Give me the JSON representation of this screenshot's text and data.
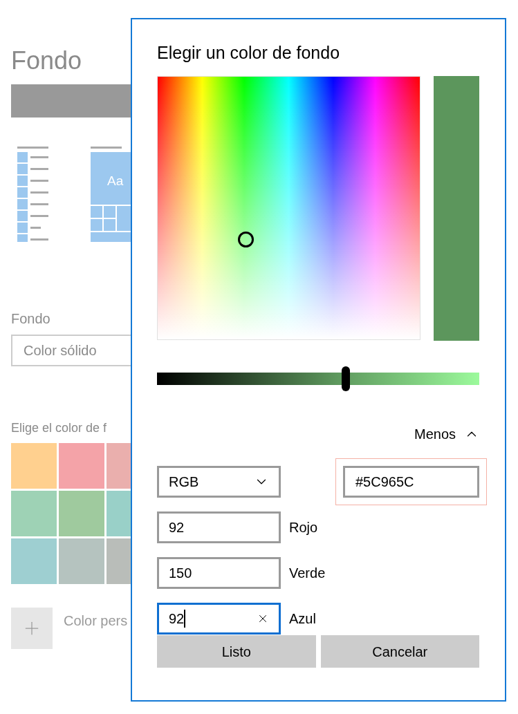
{
  "page": {
    "title": "Fondo",
    "tile_label": "Aa",
    "background_label": "Fondo",
    "background_select": "Color sólido",
    "swatches_label": "Elige el color de f",
    "swatches": [
      {
        "color": "#ffd08f"
      },
      {
        "color": "#f4a3a8"
      },
      {
        "color": "#eaafad"
      },
      {
        "color": "#9ed2b5"
      },
      {
        "color": "#9fca9e"
      },
      {
        "color": "#99d0c8"
      },
      {
        "color": "#9ecfd1"
      },
      {
        "color": "#b5c3bf"
      },
      {
        "color": "#b9bdb9"
      }
    ],
    "custom_color_label": "Color pers"
  },
  "dialog": {
    "title": "Elegir un color de fondo",
    "brightness": {
      "level": 0.586
    },
    "toggle": "Menos",
    "mode": "RGB",
    "hex": {
      "value": "#5C965C",
      "highlighted": true
    },
    "channels": [
      {
        "value": "92",
        "label": "Rojo",
        "focused": false
      },
      {
        "value": "150",
        "label": "Verde",
        "focused": false
      },
      {
        "value": "92",
        "label": "Azul",
        "focused": true
      }
    ],
    "buttons": [
      "Listo",
      "Cancelar"
    ]
  }
}
